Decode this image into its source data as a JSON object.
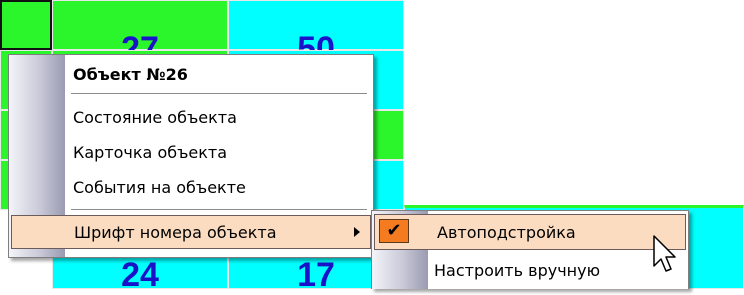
{
  "grid": {
    "visible_numbers": [
      "27",
      "50",
      "24",
      "17"
    ],
    "colors": {
      "green": "#2bf52b",
      "cyan": "#00ffff",
      "grid_line": "#e8e8e8"
    }
  },
  "context_menu": {
    "header": "Объект №26",
    "items": [
      "Состояние объекта",
      "Карточка объекта",
      "События на объекте"
    ],
    "submenu_item": "Шрифт номера объекта"
  },
  "submenu": {
    "items": [
      {
        "label": "Автоподстройка",
        "checked": true,
        "highlighted": true
      },
      {
        "label": "Настроить вручную",
        "checked": false,
        "highlighted": false
      }
    ]
  },
  "colors": {
    "highlight_bg": "#fbdcc0",
    "check_bg": "#f47b1f"
  },
  "icons": {
    "check": "checkmark-icon",
    "arrow": "submenu-arrow-icon",
    "cursor": "mouse-cursor-icon"
  }
}
